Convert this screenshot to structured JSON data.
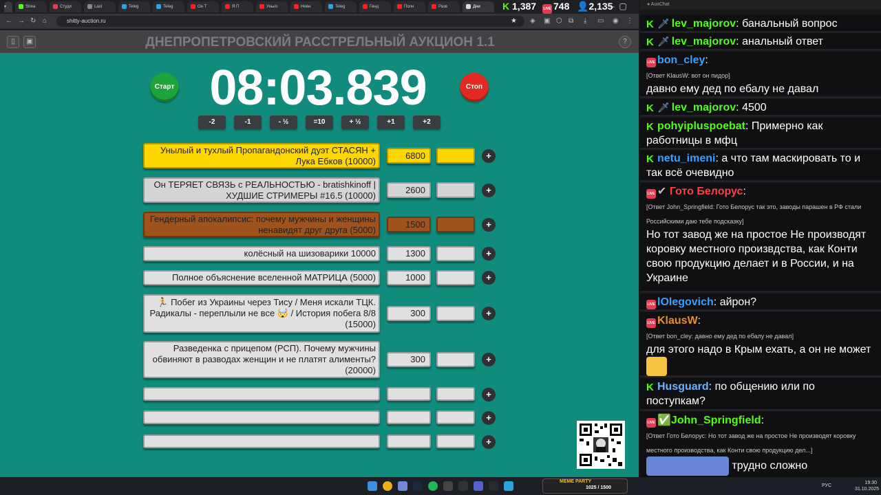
{
  "browser": {
    "tabs": [
      "Strea",
      "Студи",
      "Last",
      "Teleg",
      "Teleg",
      "Он Т",
      "Я П",
      "Унылі",
      "Невн",
      "Teleg",
      "Генд",
      "Полн",
      "Разв",
      "Дни"
    ],
    "url": "shitty-auction.ru",
    "counters": {
      "kick": "1,387",
      "live": "748",
      "viewers": "2,135"
    }
  },
  "app": {
    "title": "ДНЕПРОПЕТРОВСКИЙ РАССТРЕЛЬНЫЙ АУКЦИОН 1.1",
    "start_label": "Старт",
    "stop_label": "Стоп",
    "timer": "08:03.839",
    "adjust_buttons": [
      "-2",
      "-1",
      "- ½",
      "=10",
      "+ ½",
      "+1",
      "+2"
    ],
    "plus": "+",
    "help": "?",
    "lots": [
      {
        "name": "Унылый и тухлый Пропагандонский дуэт СТАСЯН + Лука Ебков (10000)",
        "amount": "6800",
        "color": "#ffd700"
      },
      {
        "name": "Он ТЕРЯЕТ СВЯЗЬ с РЕАЛЬНОСТЬЮ - bratishkinoff | ХУДШИЕ СТРИМЕРЫ #16.5 (10000)",
        "amount": "2600",
        "color": "#d4d4d4"
      },
      {
        "name": "Гендерный апокалипсис: почему мужчины и женщины ненавидят друг друга (5000)",
        "amount": "1500",
        "color": "#a0521c"
      },
      {
        "name": "колёсный на шизоварики 10000",
        "amount": "1300",
        "color": "#e0e0e0"
      },
      {
        "name": "Полное объяснение вселенной МАТРИЦА (5000)",
        "amount": "1000",
        "color": "#e0e0e0"
      },
      {
        "name": "🏃 Побег из Украины через Тису / Меня искали ТЦК. Радикалы - переплыли не все 🤯 / История побега 8/8 (15000)",
        "amount": "300",
        "color": "#e0e0e0"
      },
      {
        "name": "Разведенка с прицепом (РСП). Почему мужчины обвиняют в разводах женщин и не платят алименты? (20000)",
        "amount": "300",
        "color": "#e0e0e0"
      },
      {
        "name": "",
        "amount": "",
        "color": "#e0e0e0"
      },
      {
        "name": "",
        "amount": "",
        "color": "#e0e0e0"
      },
      {
        "name": "",
        "amount": "",
        "color": "#e0e0e0"
      }
    ]
  },
  "chat": {
    "title": "AuxChat",
    "messages": [
      {
        "nick": "lev_majorov",
        "text": "банальный вопрос",
        "color": "#53fc18"
      },
      {
        "nick": "lev_majorov",
        "text": "анальный ответ",
        "color": "#53fc18"
      },
      {
        "nick": "bon_cley",
        "reply": "[Ответ KlausW: вот он пидор]",
        "text": "давно ему дед по ебалу не давал",
        "color": "#3aa0ff"
      },
      {
        "nick": "lev_majorov",
        "text": "4500",
        "color": "#53fc18"
      },
      {
        "nick": "pohyiplusрoebat",
        "text": "Примерно как работницы в мфц",
        "color": "#53fc18"
      },
      {
        "nick": "netu_imeni",
        "text": "а что там маскировать то и так всё очевидно",
        "color": "#3aa0ff"
      },
      {
        "nick": "Гото Белорус",
        "reply": "[Ответ John_Springfield: Гото Белорус так это, заводы парашен в РФ стали Российскими даю тебе подсказку]",
        "text": "Но тот завод же на простое Не производят коровку местного произвдства, как Конти свою продукцию делает и в России, и на Украине",
        "color": "#ff4040"
      },
      {
        "nick": "lOlegovich",
        "text": "айрон?",
        "color": "#3aa0ff"
      },
      {
        "nick": "KlausW",
        "reply": "[Ответ bon_cley: давно ему дед по ебалу не давал]",
        "text": "для этого надо в Крым ехать, а он не может",
        "color": "#e88b2e"
      },
      {
        "nick": "Husguard",
        "text": "по общению или по поступкам?",
        "color": "#6fb0ff"
      },
      {
        "nick": "John_Springfield",
        "reply": "[Ответ Гото Белорус: Но тот завод же на простое Не производят коровку местного производства, как Конти свою продукцию дел...]",
        "text": "трудно сложно",
        "color": "#53fc18"
      }
    ]
  },
  "taskbar": {
    "lang": "РУС",
    "time": "19:30",
    "date": "31.10.2025",
    "widget": "MEME PARTY",
    "widget_sub": "1025 / 1500"
  }
}
